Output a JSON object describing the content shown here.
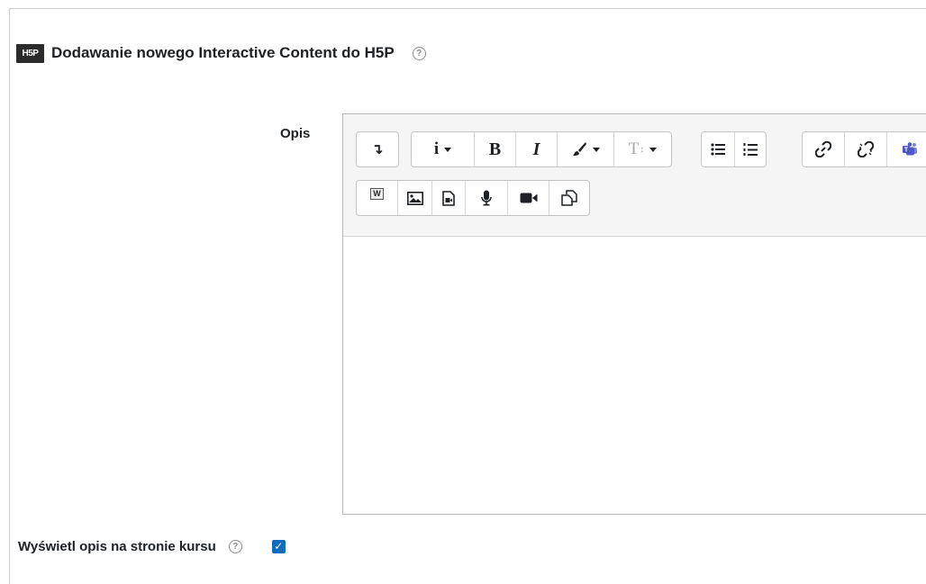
{
  "header": {
    "logo_text": "H5P",
    "title": "Dodawanie nowego Interactive Content do H5P",
    "help_glyph": "?"
  },
  "form": {
    "description_label": "Opis",
    "display_label": "Wyświetl opis na stronie kursu",
    "display_help_glyph": "?",
    "display_checked": true,
    "check_glyph": "✓"
  },
  "toolbar": {
    "collapse_glyph": "↴",
    "info_label": "i",
    "bold_label": "B",
    "italic_label": "I",
    "color_glyph": "🖌",
    "font_size_label": "T",
    "bullet_list_glyph": "☰",
    "numbered_list_glyph": "☷",
    "link_glyph": "🔗",
    "unlink_glyph": "⛓",
    "teams_glyph": "👥",
    "word_paste_label": "W",
    "image_glyph": "🖼",
    "media_glyph": "🎞",
    "record_audio_glyph": "🎙",
    "record_video_glyph": "🎥",
    "manage_files_glyph": "⎘"
  },
  "icons": {
    "logo": "h5p-logo",
    "help": "question-circle-icon"
  },
  "colors": {
    "accent": "#0f6cbf",
    "logo_bg": "#2b2b2b",
    "toolbar_bg": "#f5f5f5"
  }
}
